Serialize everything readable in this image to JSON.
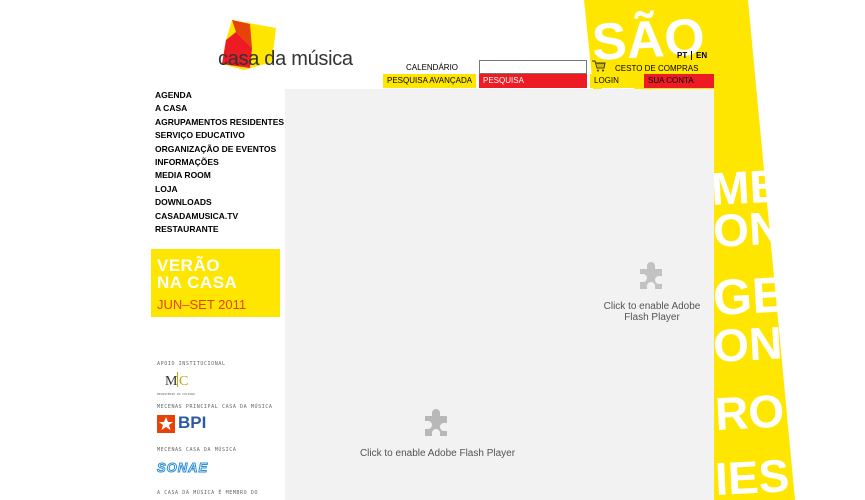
{
  "logo": {
    "text": "casa da música"
  },
  "topbar": {
    "calendar": "CALENDÁRIO",
    "search_value": "",
    "cart": "CESTO DE COMPRAS",
    "lang_pt": "PT",
    "lang_en": "EN",
    "advanced_search": "PESQUISA AVANÇADA",
    "search": "PESQUISA",
    "login": "LOGIN",
    "account": "SUA CONTA"
  },
  "nav": {
    "items": [
      {
        "label": "AGENDA"
      },
      {
        "label": "A CASA"
      },
      {
        "label": "AGRUPAMENTOS RESIDENTES"
      },
      {
        "label": "SERVIÇO EDUCATIVO"
      },
      {
        "label": "ORGANIZAÇÃO DE EVENTOS"
      },
      {
        "label": "INFORMAÇÕES"
      },
      {
        "label": "MEDIA ROOM"
      },
      {
        "label": "LOJA"
      },
      {
        "label": "DOWNLOADS"
      },
      {
        "label": "CASADAMUSICA.TV"
      },
      {
        "label": "RESTAURANTE"
      }
    ]
  },
  "banner": {
    "line1": "VERÃO",
    "line2": "NA CASA",
    "line3": "JUN–SET 2011"
  },
  "flash": {
    "message_right_1": "Click to enable Adobe",
    "message_right_2": "Flash Player",
    "message_center": "Click to enable Adobe Flash Player"
  },
  "sponsors": {
    "label_1": "APOIO INSTITUCIONAL",
    "mc_caption": "Ministério da Cultura",
    "label_2": "MECENAS PRINCIPAL CASA DA MÚSICA",
    "bpi": "BPI",
    "label_3": "MECENAS CASA DA MÚSICA",
    "sonae": "SONAE",
    "label_4": "A CASA DA MÚSICA É MEMBRO DO"
  },
  "poster": {
    "text_top": "SÃO",
    "fragments": [
      "ME",
      "ON",
      "GE",
      "ON",
      "RON",
      "IES"
    ]
  },
  "colors": {
    "yellow": "#ffe600",
    "red": "#ed1c24",
    "flash_bg": "#f2f2f2"
  }
}
